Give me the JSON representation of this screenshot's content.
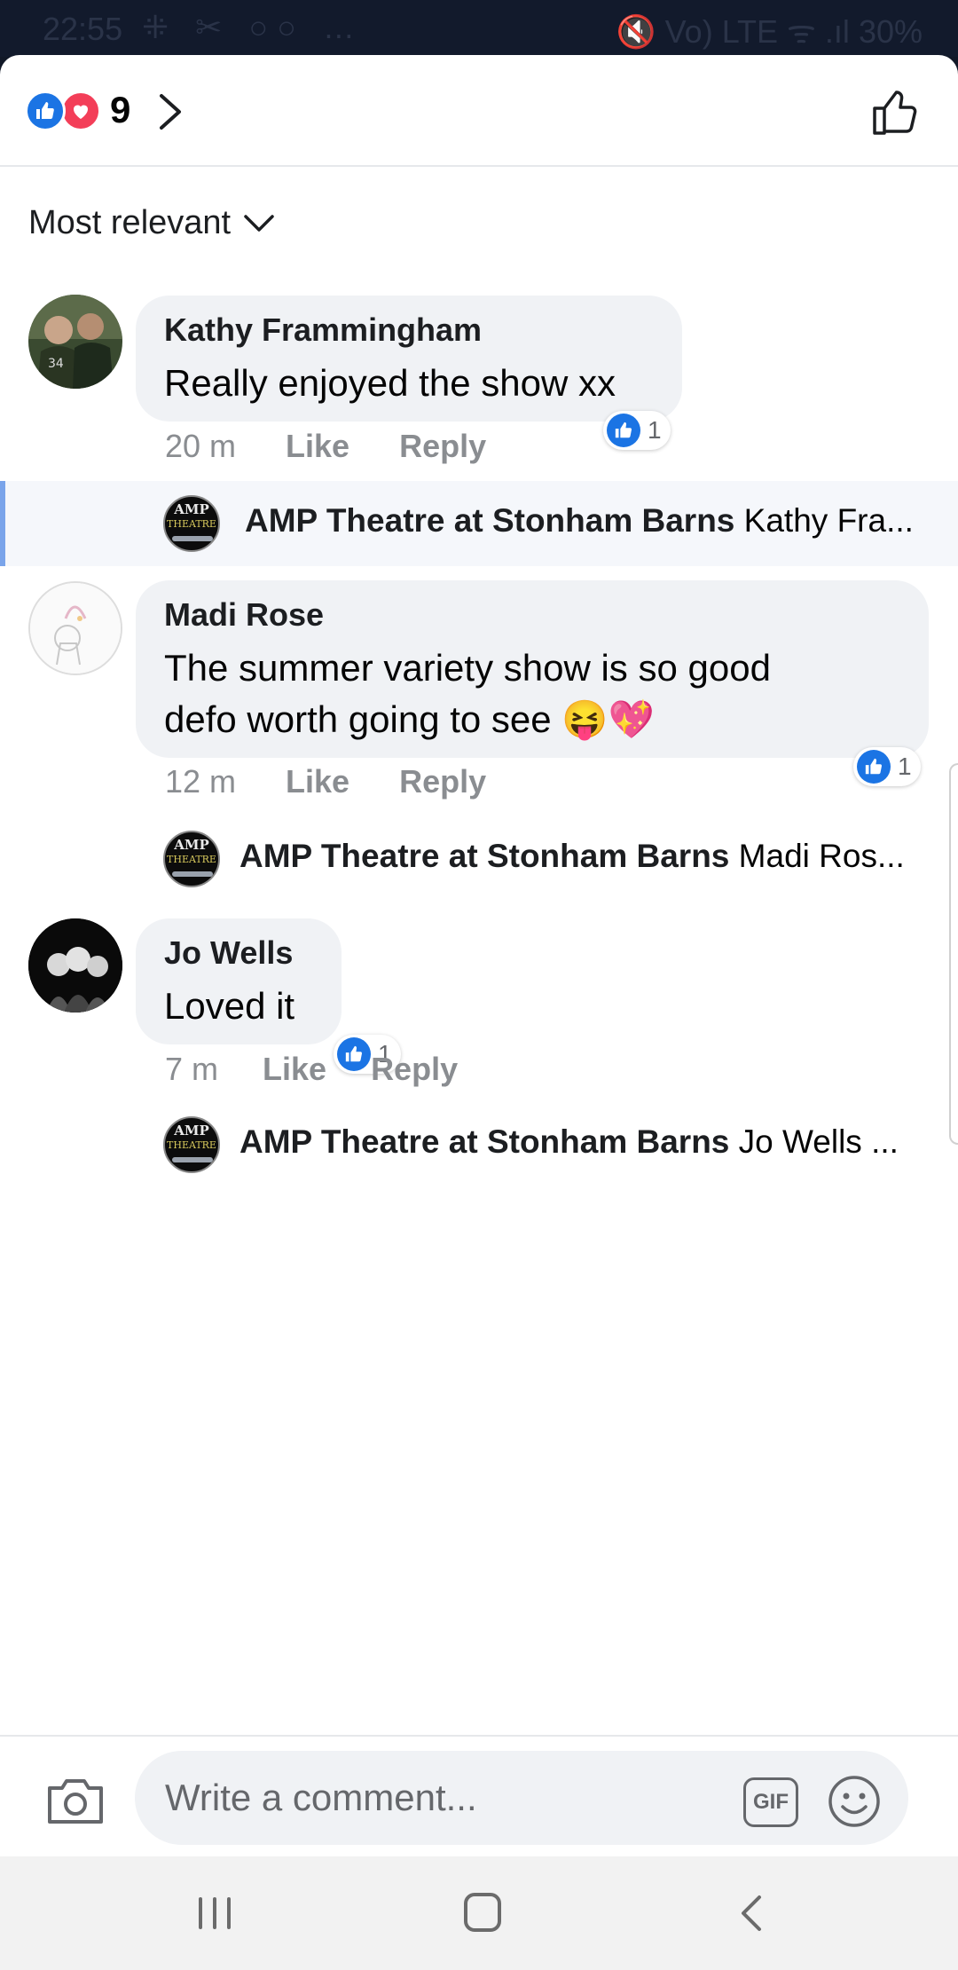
{
  "status_bar": {
    "time": "22:55",
    "left_icons": "⁜ ✂ ○○ …",
    "right_icons": "🔇 Vo) LTE ᯤ .ıl",
    "battery": "30%"
  },
  "header": {
    "reaction_count": "9",
    "reactions": [
      "like-reaction-icon",
      "love-reaction-icon"
    ]
  },
  "sort": {
    "label": "Most relevant"
  },
  "comments": [
    {
      "author": "Kathy Frammingham",
      "text": "Really enjoyed the show xx",
      "time": "20 m",
      "like_label": "Like",
      "reply_label": "Reply",
      "reaction_count": "1",
      "reply_preview": {
        "author": "AMP Theatre at Stonham Barns",
        "snippet": "Kathy Fra..."
      }
    },
    {
      "author": "Madi Rose",
      "text_line1": "The summer variety show is so good",
      "text_line2": "defo worth going to see 😝💖",
      "time": "12 m",
      "like_label": "Like",
      "reply_label": "Reply",
      "reaction_count": "1",
      "reply_preview": {
        "author": "AMP Theatre at Stonham Barns",
        "snippet": "Madi Ros..."
      }
    },
    {
      "author": "Jo Wells",
      "text": "Loved it",
      "time": "7 m",
      "like_label": "Like",
      "reply_label": "Reply",
      "reaction_count": "1",
      "reply_preview": {
        "author": "AMP Theatre at Stonham Barns",
        "snippet": "Jo Wells ..."
      }
    }
  ],
  "page_avatar": {
    "line1": "AMP",
    "line2": "THEATRE"
  },
  "composer": {
    "placeholder": "Write a comment...",
    "gif_label": "GIF"
  },
  "colors": {
    "brand_blue": "#1b74e4",
    "love_red": "#f33e58",
    "bubble_bg": "#f0f2f5",
    "meta_gray": "#8a8d91"
  }
}
